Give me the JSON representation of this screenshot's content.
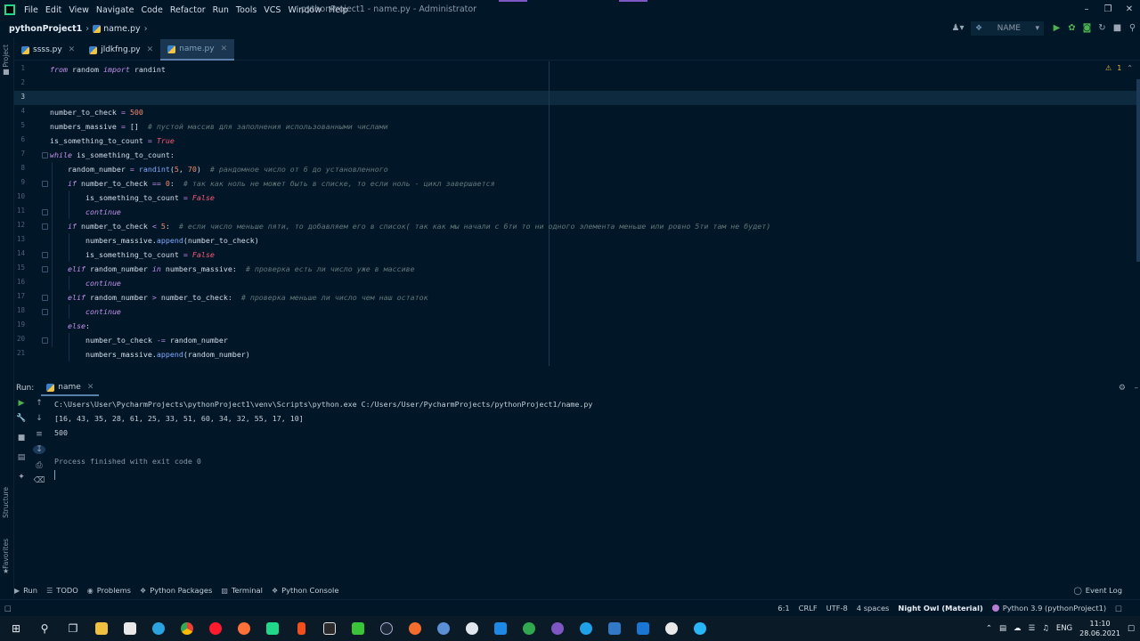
{
  "menu": [
    "File",
    "Edit",
    "View",
    "Navigate",
    "Code",
    "Refactor",
    "Run",
    "Tools",
    "VCS",
    "Window",
    "Help"
  ],
  "window_title": "pythonProject1 - name.py - Administrator",
  "breadcrumb": {
    "project": "pythonProject1",
    "file": "name.py"
  },
  "run_config": "NAME",
  "tabs": [
    {
      "label": "ssss.py",
      "active": false
    },
    {
      "label": "jldkfng.py",
      "active": false
    },
    {
      "label": "name.py",
      "active": true
    }
  ],
  "inspection": {
    "warnings": "1"
  },
  "editor_lines": [
    {
      "n": "1",
      "html": "<span class='kw'>from</span> random <span class='kw'>import</span> randint"
    },
    {
      "n": "2",
      "html": ""
    },
    {
      "n": "3",
      "html": ""
    },
    {
      "n": "4",
      "html": "number_to_check <span class='op'>=</span> <span class='num'>500</span>"
    },
    {
      "n": "5",
      "html": "numbers_massive <span class='op'>=</span> []  <span class='cm'># пустой массив для заполнения использованными числами</span>"
    },
    {
      "n": "6",
      "html": "is_something_to_count <span class='op'>=</span> <span class='bool'>True</span>"
    },
    {
      "n": "7",
      "html": "<span class='kw'>while</span> is_something_to_count:"
    },
    {
      "n": "8",
      "html": "    random_number <span class='op'>=</span> <span class='fn'>randint</span>(<span class='num'>5</span>, <span class='num'>70</span>)  <span class='cm'># рандомное число от 6 до установленного</span>"
    },
    {
      "n": "9",
      "html": "    <span class='kw'>if</span> number_to_check <span class='op'>==</span> <span class='num'>0</span>:  <span class='cm'># так как ноль не может быть в списке, то если ноль - цикл завершается</span>"
    },
    {
      "n": "10",
      "html": "        is_something_to_count <span class='op'>=</span> <span class='bool'>False</span>"
    },
    {
      "n": "11",
      "html": "        <span class='kw'>continue</span>"
    },
    {
      "n": "12",
      "html": "    <span class='kw'>if</span> number_to_check <span class='op'>&lt;</span> <span class='num'>5</span>:  <span class='cm'># если число меньше пяти, то добавляем его в список( так как мы начали с 6ти то ни одного элемента меньше или ровно 5ти там не будет)</span>"
    },
    {
      "n": "13",
      "html": "        numbers_massive.<span class='fn'>append</span>(number_to_check)"
    },
    {
      "n": "14",
      "html": "        is_something_to_count <span class='op'>=</span> <span class='bool'>False</span>"
    },
    {
      "n": "15",
      "html": "    <span class='kw'>elif</span> random_number <span class='kw'>in</span> numbers_massive:  <span class='cm'># проверка есть ли число уже в массиве</span>"
    },
    {
      "n": "16",
      "html": "        <span class='kw'>continue</span>"
    },
    {
      "n": "17",
      "html": "    <span class='kw'>elif</span> random_number <span class='op'>&gt;</span> number_to_check:  <span class='cm'># проверка меньше ли число чем наш остаток</span>"
    },
    {
      "n": "18",
      "html": "        <span class='kw'>continue</span>"
    },
    {
      "n": "19",
      "html": "    <span class='kw'>else</span>:"
    },
    {
      "n": "20",
      "html": "        number_to_check <span class='op'>-=</span> random_number"
    },
    {
      "n": "21",
      "html": "        numbers_massive.<span class='fn'>append</span>(random_number)"
    }
  ],
  "run_panel": {
    "label": "Run:",
    "tab": "name",
    "console": [
      "C:\\Users\\User\\PycharmProjects\\pythonProject1\\venv\\Scripts\\python.exe C:/Users/User/PycharmProjects/pythonProject1/name.py",
      "[16, 43, 35, 28, 61, 25, 33, 51, 60, 34, 32, 55, 17, 10]",
      "500",
      "",
      "Process finished with exit code 0"
    ]
  },
  "side_labels": {
    "project": "Project",
    "structure": "Structure",
    "favorites": "Favorites"
  },
  "tool_tabs": [
    "Run",
    "TODO",
    "Problems",
    "Python Packages",
    "Terminal",
    "Python Console"
  ],
  "event_log": "Event Log",
  "status": {
    "position": "6:1",
    "line_sep": "CRLF",
    "encoding": "UTF-8",
    "indent": "4 spaces",
    "theme": "Night Owl (Material)",
    "interpreter": "Python 3.9 (pythonProject1)"
  },
  "systray": {
    "lang": "ENG",
    "time": "11:10",
    "date": "28.06.2021"
  }
}
